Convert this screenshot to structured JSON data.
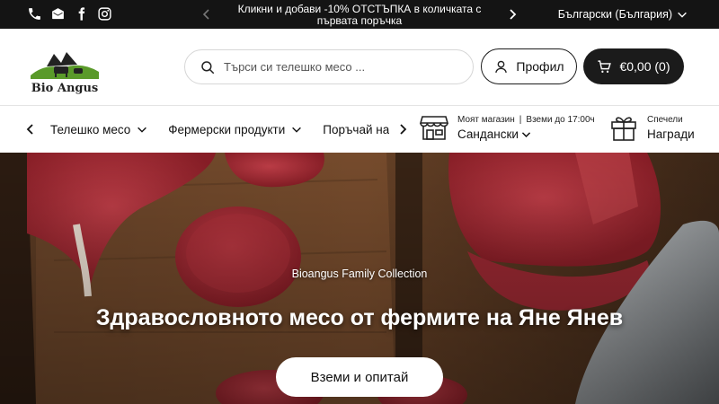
{
  "topbar": {
    "social": [
      "phone-icon",
      "email-icon",
      "facebook-icon",
      "instagram-icon"
    ],
    "announcement": "Кликни и добави -10% ОТСТЪПКА в количката с първата поръчка",
    "language": "Български (България)"
  },
  "header": {
    "logo_text": "Bio Angus",
    "search_placeholder": "Търси си телешко месо ...",
    "profile_label": "Профил",
    "cart_label": "€0,00 (0)"
  },
  "nav": {
    "items": [
      {
        "label": "Телешко месо"
      },
      {
        "label": "Фермерски продукти"
      },
      {
        "label": "Поръчай на едро"
      }
    ],
    "store": {
      "title": "Моят магазин",
      "hours": "Вземи до 17:00ч",
      "city": "Сандански"
    },
    "rewards": {
      "title": "Спечели",
      "label": "Награди"
    }
  },
  "hero": {
    "subtitle": "Bioangus Family Collection",
    "title": "Здравословното месо от фермите на Яне Янев",
    "cta": "Вземи и опитай"
  },
  "colors": {
    "topbar_bg": "#141414",
    "cart_bg": "#1b1b1b",
    "logo_green": "#5a9a2a"
  }
}
